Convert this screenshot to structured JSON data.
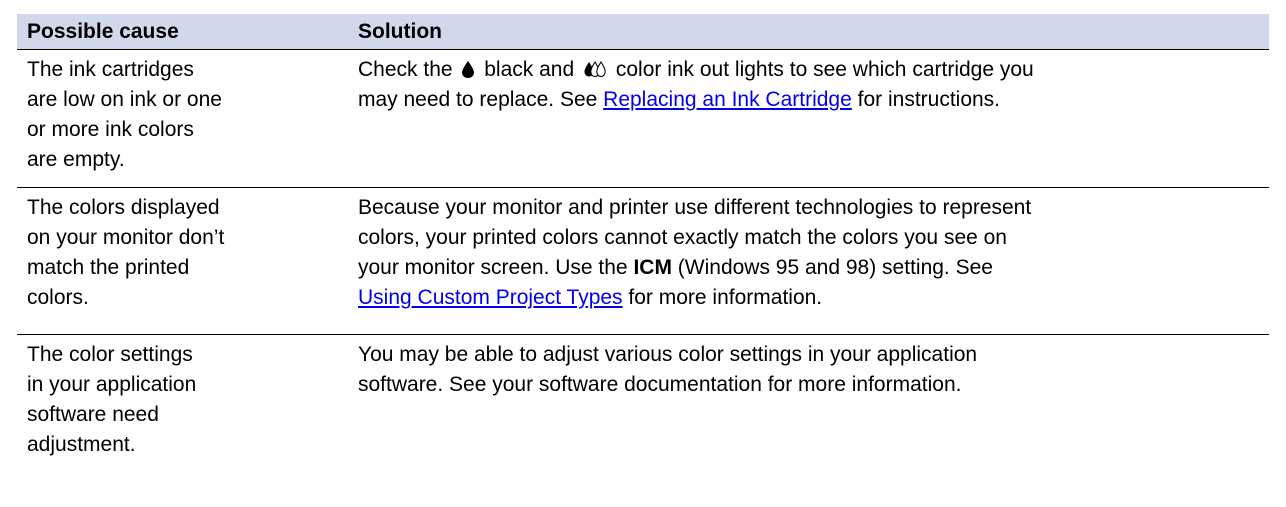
{
  "table": {
    "headers": {
      "cause": "Possible cause",
      "solution": "Solution"
    },
    "rows": [
      {
        "cause_lines": [
          "The ink cartridges",
          "are low on ink or one",
          "or more ink colors",
          "are empty."
        ],
        "solution": {
          "line1_pre": "Check the",
          "black_icon": "black-ink-drop-icon",
          "line1_black": "black and",
          "color_icon": "color-ink-drops-icon",
          "line1_post": "color ink out lights to see which cartridge you",
          "line2_pre": "may need to replace. See ",
          "link": "Replacing an Ink Cartridge",
          "line2_post": " for instructions."
        }
      },
      {
        "cause_lines": [
          "The colors displayed",
          "on your monitor don’t",
          "match the printed",
          "colors."
        ],
        "solution": {
          "line1": "Because your monitor and printer use different technologies to represent",
          "line2": "colors, your printed colors cannot exactly match the colors you see on",
          "line3_pre": "your monitor screen. Use the ",
          "line3_bold": "ICM",
          "line3_post": " (Windows 95 and 98) setting. See",
          "link": "Using Custom Project Types",
          "line4_post": " for more information."
        }
      },
      {
        "cause_lines": [
          "The color settings",
          "in your application",
          "software need",
          "adjustment."
        ],
        "solution": {
          "line1": "You may be able to adjust various color settings in your application",
          "line2": "software. See your software documentation for more information."
        }
      }
    ]
  }
}
